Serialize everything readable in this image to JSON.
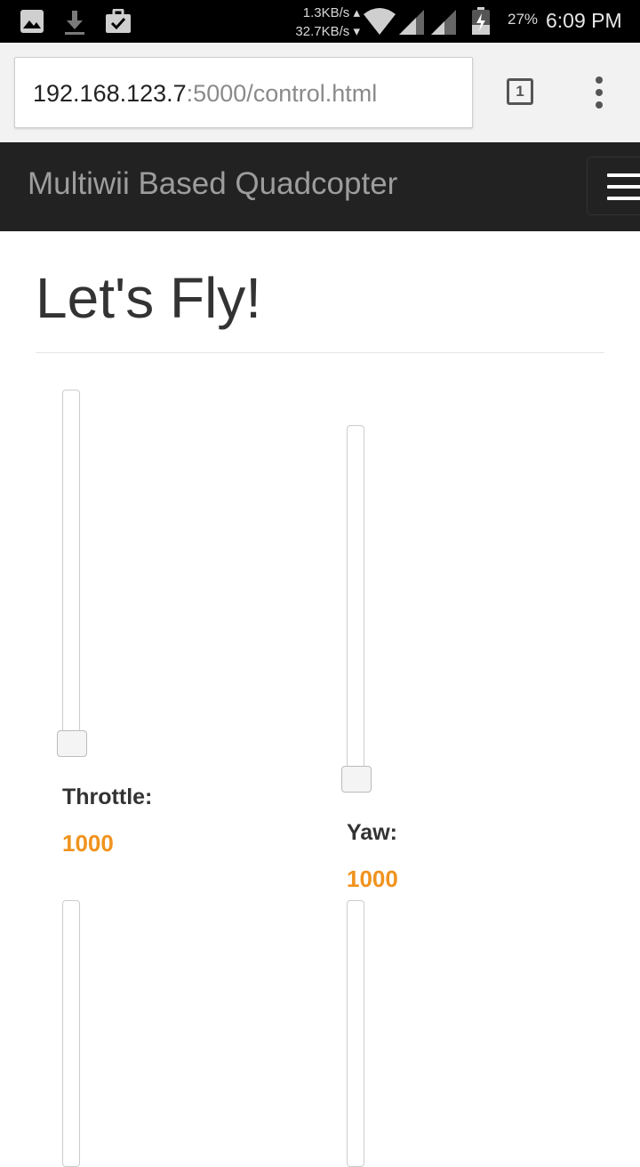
{
  "status_bar": {
    "net_up": "1.3KB/s",
    "net_down": "32.7KB/s",
    "battery": "27%",
    "time": "6:09 PM",
    "icons": [
      "image-icon",
      "download-icon",
      "shopping-bag-check-icon",
      "wifi-icon",
      "cell-signal-icon",
      "cell-signal-icon",
      "battery-icon"
    ]
  },
  "browser": {
    "url_host": "192.168.123.7",
    "url_path": ":5000/control.html",
    "tab_count": "1"
  },
  "navbar": {
    "brand": "Multiwii Based Quadcopter"
  },
  "page": {
    "title": "Let's Fly!"
  },
  "controls": [
    {
      "label": "Throttle:",
      "value": "1000"
    },
    {
      "label": "Yaw:",
      "value": "1000"
    }
  ],
  "colors": {
    "value_accent": "#f0931e",
    "navbar_bg": "#222222"
  }
}
